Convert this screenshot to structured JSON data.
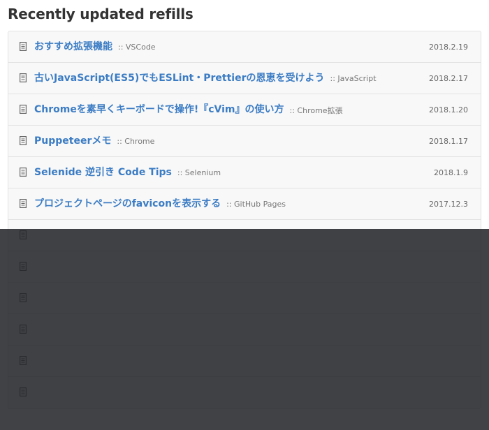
{
  "section": {
    "title": "Recently updated refills"
  },
  "refills": [
    {
      "title": "おすすめ拡張機能",
      "category": ":: VSCode",
      "date": "2018.2.19"
    },
    {
      "title": "古いJavaScript(ES5)でもESLint・Prettierの恩恵を受けよう",
      "category": ":: JavaScript",
      "date": "2018.2.17"
    },
    {
      "title": "Chromeを素早くキーボードで操作!『cVim』の使い方",
      "category": ":: Chrome拡張",
      "date": "2018.1.20"
    },
    {
      "title": "Puppeteerメモ",
      "category": ":: Chrome",
      "date": "2018.1.17"
    },
    {
      "title": "Selenide 逆引き Code Tips",
      "category": ":: Selenium",
      "date": "2018.1.9"
    },
    {
      "title": "プロジェクトページのfaviconを表示する",
      "category": ":: GitHub Pages",
      "date": "2017.12.3"
    },
    {
      "title": "",
      "category": "",
      "date": ""
    },
    {
      "title": "",
      "category": "",
      "date": ""
    },
    {
      "title": "",
      "category": "",
      "date": ""
    },
    {
      "title": "",
      "category": "",
      "date": ""
    },
    {
      "title": "",
      "category": "",
      "date": ""
    },
    {
      "title": "",
      "category": "",
      "date": ""
    }
  ],
  "icons": {
    "row_icon": "document-icon"
  },
  "colors": {
    "link": "#3b7cc4",
    "overlay": "#222326"
  }
}
